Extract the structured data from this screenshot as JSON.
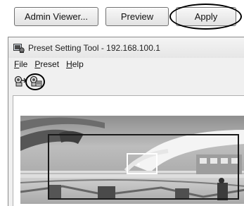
{
  "top_buttons": {
    "admin_viewer": "Admin Viewer...",
    "preview": "Preview",
    "apply": "Apply"
  },
  "window": {
    "title": "Preset Setting Tool - 192.168.100.1",
    "menu": [
      "File",
      "Preset",
      "Help"
    ],
    "toolbar": {
      "icons": [
        "add-camera-icon",
        "camera-settings-icon"
      ]
    }
  },
  "colors": {
    "highlight": "#000000",
    "button_border": "#707070"
  }
}
